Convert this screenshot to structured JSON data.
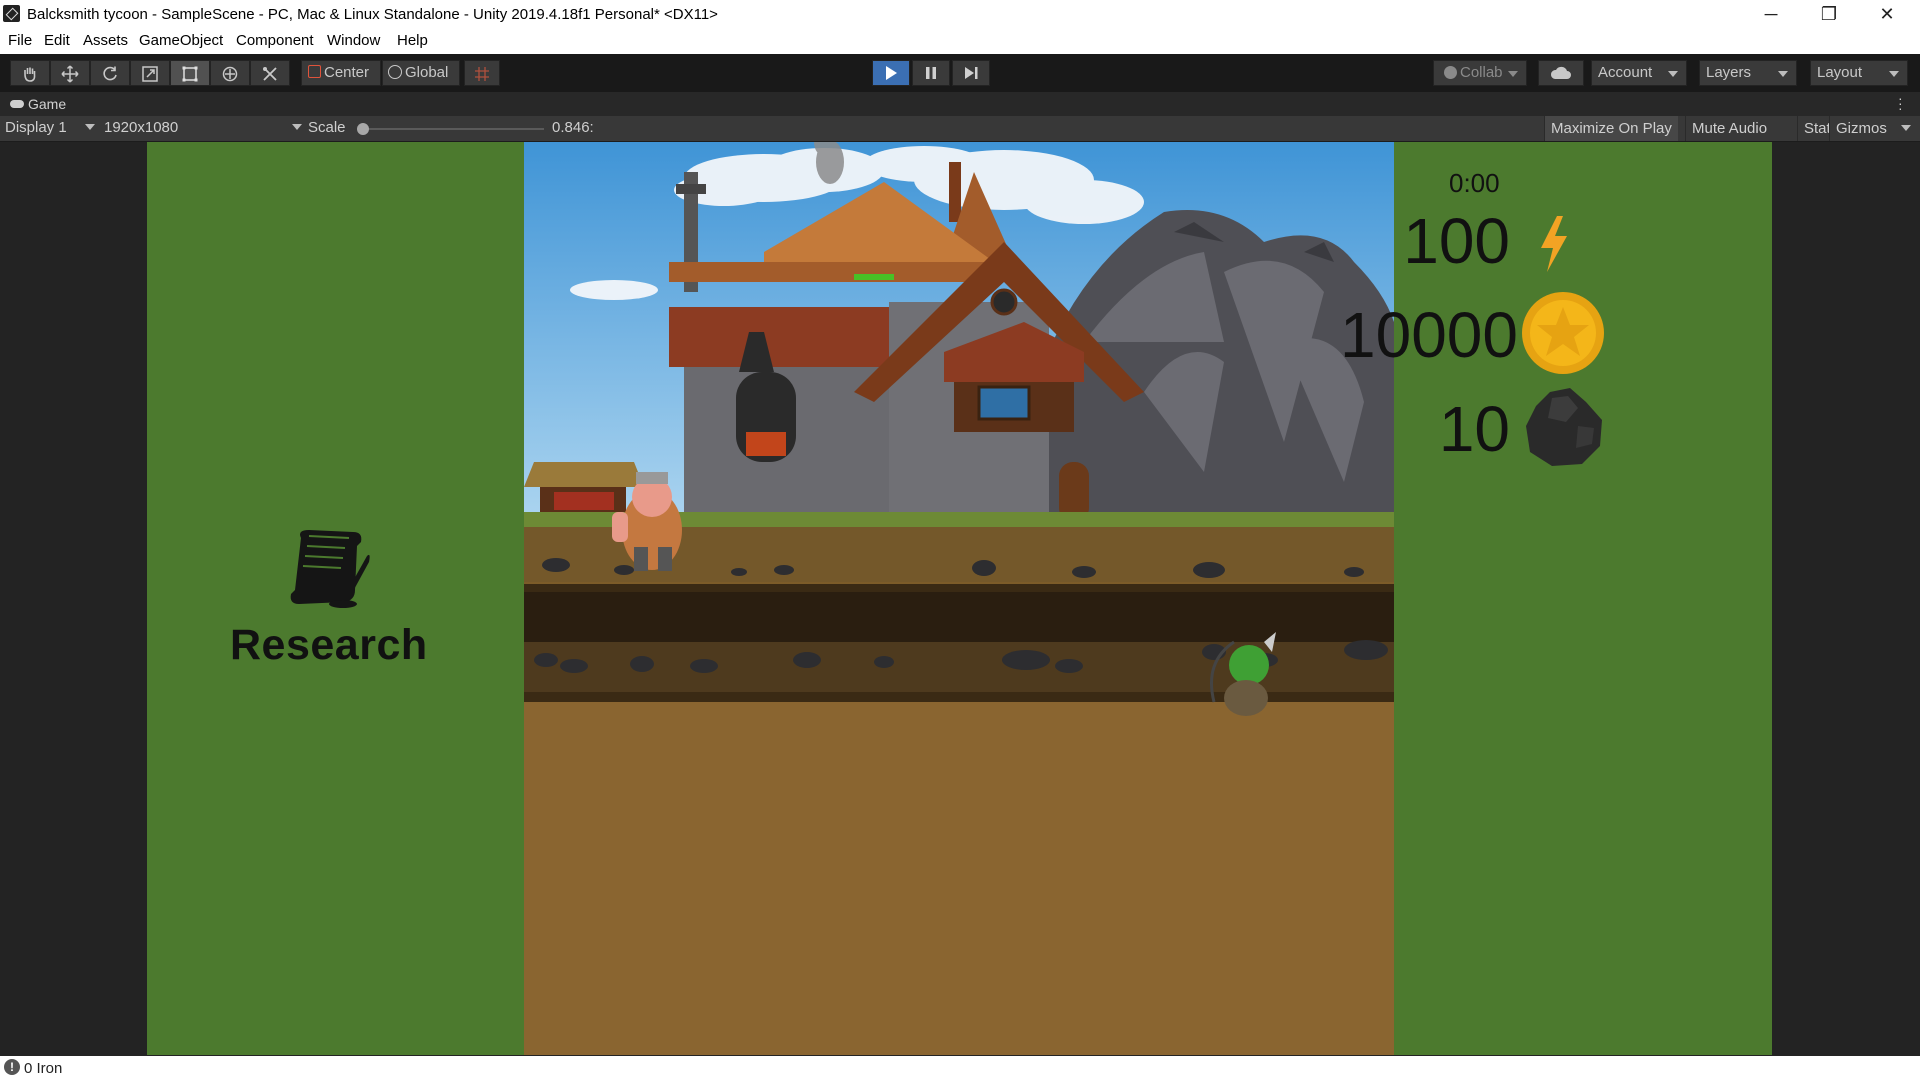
{
  "window": {
    "title": "Balcksmith tycoon - SampleScene - PC, Mac & Linux Standalone - Unity 2019.4.18f1 Personal* <DX11>",
    "controls": {
      "minimize": "─",
      "restore": "❐",
      "close": "✕"
    }
  },
  "menu": [
    "File",
    "Edit",
    "Assets",
    "GameObject",
    "Component",
    "Window",
    "Help"
  ],
  "toolbar": {
    "tools": [
      "hand-icon",
      "move-icon",
      "rotate-icon",
      "scale-icon",
      "rect-icon",
      "transform-icon",
      "custom-tool-icon"
    ],
    "pivot_label": "Center",
    "space_label": "Global",
    "collab_label": "Collab",
    "account_label": "Account",
    "layers_label": "Layers",
    "layout_label": "Layout"
  },
  "game_tab": {
    "label": "Game",
    "display": "Display 1",
    "resolution": "1920x1080",
    "scale_label": "Scale",
    "scale_value": "0.846:",
    "scale_fraction": 0.0,
    "buttons": {
      "maximize": "Maximize On Play",
      "mute": "Mute Audio",
      "stats": "Stats",
      "gizmos": "Gizmos"
    }
  },
  "game": {
    "timer": "0:00",
    "energy": "100",
    "coins": "10000",
    "ore": "10",
    "research_label": "Research"
  },
  "status": {
    "text": "0 Iron"
  },
  "colors": {
    "panel_green": "#4c7a2e",
    "play_blue": "#3b6fb3",
    "energy_orange": "#f2a324",
    "coin_gold": "#f4b619"
  }
}
